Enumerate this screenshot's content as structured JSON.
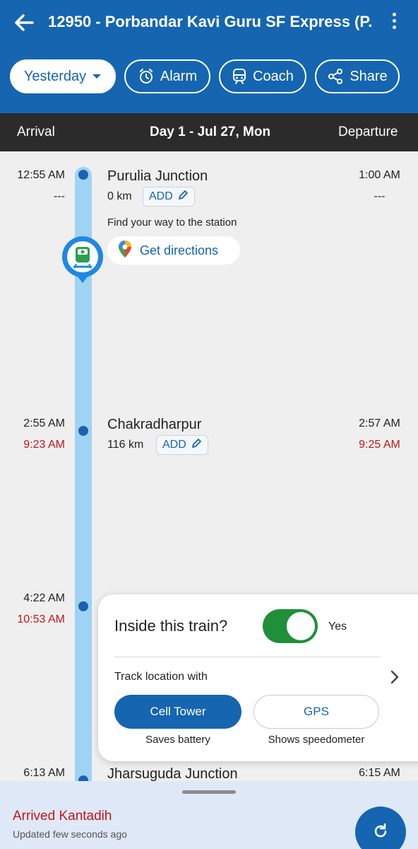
{
  "header": {
    "title": "12950 - Porbandar Kavi Guru SF Express (P...",
    "chips": {
      "date": "Yesterday",
      "alarm": "Alarm",
      "coach": "Coach",
      "share": "Share"
    }
  },
  "daybar": {
    "arrival": "Arrival",
    "day": "Day 1 - Jul 27, Mon",
    "departure": "Departure"
  },
  "stations": [
    {
      "name": "Purulia Junction",
      "km": "0 km",
      "add": "ADD",
      "arr_sched": "12:55 AM",
      "arr_actual": "---",
      "dep_sched": "1:00 AM",
      "dep_actual": "---",
      "find_way": "Find your way to the station",
      "directions": "Get directions"
    },
    {
      "name": "Chakradharpur",
      "km": "116 km",
      "add": "ADD",
      "arr_sched": "2:55 AM",
      "arr_actual": "9:23 AM",
      "dep_sched": "2:57 AM",
      "dep_actual": "9:25 AM"
    },
    {
      "arr_sched": "4:22 AM",
      "arr_actual": "10:53 AM"
    },
    {
      "name": "Jharsuguda Junction",
      "arr_sched": "6:13 AM",
      "dep_sched": "6:15 AM"
    }
  ],
  "inside_card": {
    "question": "Inside this train?",
    "toggle_label": "Yes",
    "toggle_on": true,
    "track_label": "Track location with",
    "options": [
      {
        "label": "Cell Tower",
        "caption": "Saves battery",
        "selected": true
      },
      {
        "label": "GPS",
        "caption": "Shows speedometer",
        "selected": false
      }
    ]
  },
  "status": {
    "arrived": "Arrived Kantadih",
    "updated": "Updated few seconds ago"
  },
  "colors": {
    "primary": "#1565b0",
    "late": "#c0181a",
    "toggle": "#1f8f3a",
    "track": "#9fd3f3"
  }
}
